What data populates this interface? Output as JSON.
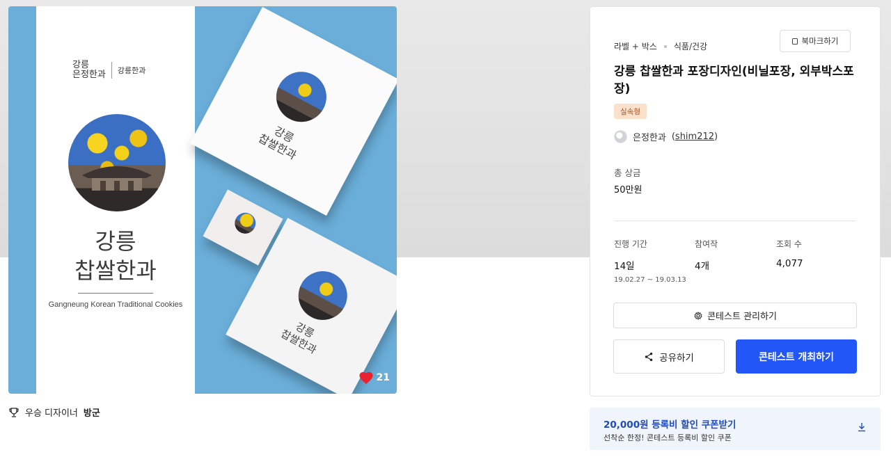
{
  "hero": {
    "brand_left": "강릉\n은정한과",
    "brand_right": "강릉한과",
    "title_line1": "강릉",
    "title_line2": "찹쌀한과",
    "subtitle": "Gangneung Korean Traditional Cookies",
    "box_title": "강릉\n찹쌀한과",
    "like_count": "21",
    "like_color": "#e8232f"
  },
  "winner": {
    "label": "우승 디자이너",
    "name": "방군"
  },
  "card": {
    "category_main": "라벨 + 박스",
    "category_sub": "식품/건강",
    "bookmark_label": "북마크하기",
    "title": "강릉 찹쌀한과 포장디자인(비닐포장, 외부박스포장)",
    "badge": "실속형",
    "host_name": "은정한과",
    "host_id": "shim212",
    "prize_label": "총 상금",
    "prize_value": "50만원",
    "stats": [
      {
        "label": "진행 기간",
        "value": "14일",
        "sub": "19.02.27 ~ 19.03.13"
      },
      {
        "label": "참여작",
        "value": "4개",
        "sub": ""
      },
      {
        "label": "조회 수",
        "value": "4,077",
        "sub": ""
      }
    ],
    "manage_label": "콘테스트 관리하기",
    "share_label": "공유하기",
    "host_contest_label": "콘테스트 개최하기",
    "accent_color": "#2356f6"
  },
  "coupon": {
    "headline": "20,000원 등록비 할인 쿠폰받기",
    "detail": "선착순 한정! 콘테스트 등록비 할인 쿠폰"
  }
}
